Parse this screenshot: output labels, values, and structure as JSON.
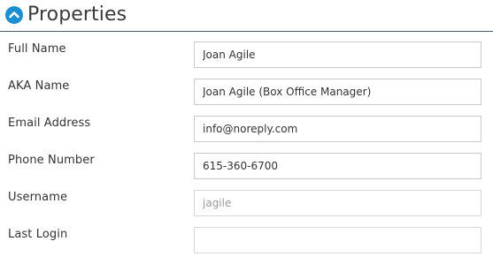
{
  "section": {
    "title": "Properties",
    "toggle_icon": "chevron-up-icon",
    "accent_color": "#1b8fd2"
  },
  "fields": [
    {
      "label": "Full Name",
      "value": "Joan Agile"
    },
    {
      "label": "AKA Name",
      "value": "Joan Agile (Box Office Manager)"
    },
    {
      "label": "Email Address",
      "value": "info@noreply.com"
    },
    {
      "label": "Phone Number",
      "value": "615-360-6700"
    },
    {
      "label": "Username",
      "value": "jagile"
    },
    {
      "label": "Last Login",
      "value": ""
    }
  ]
}
